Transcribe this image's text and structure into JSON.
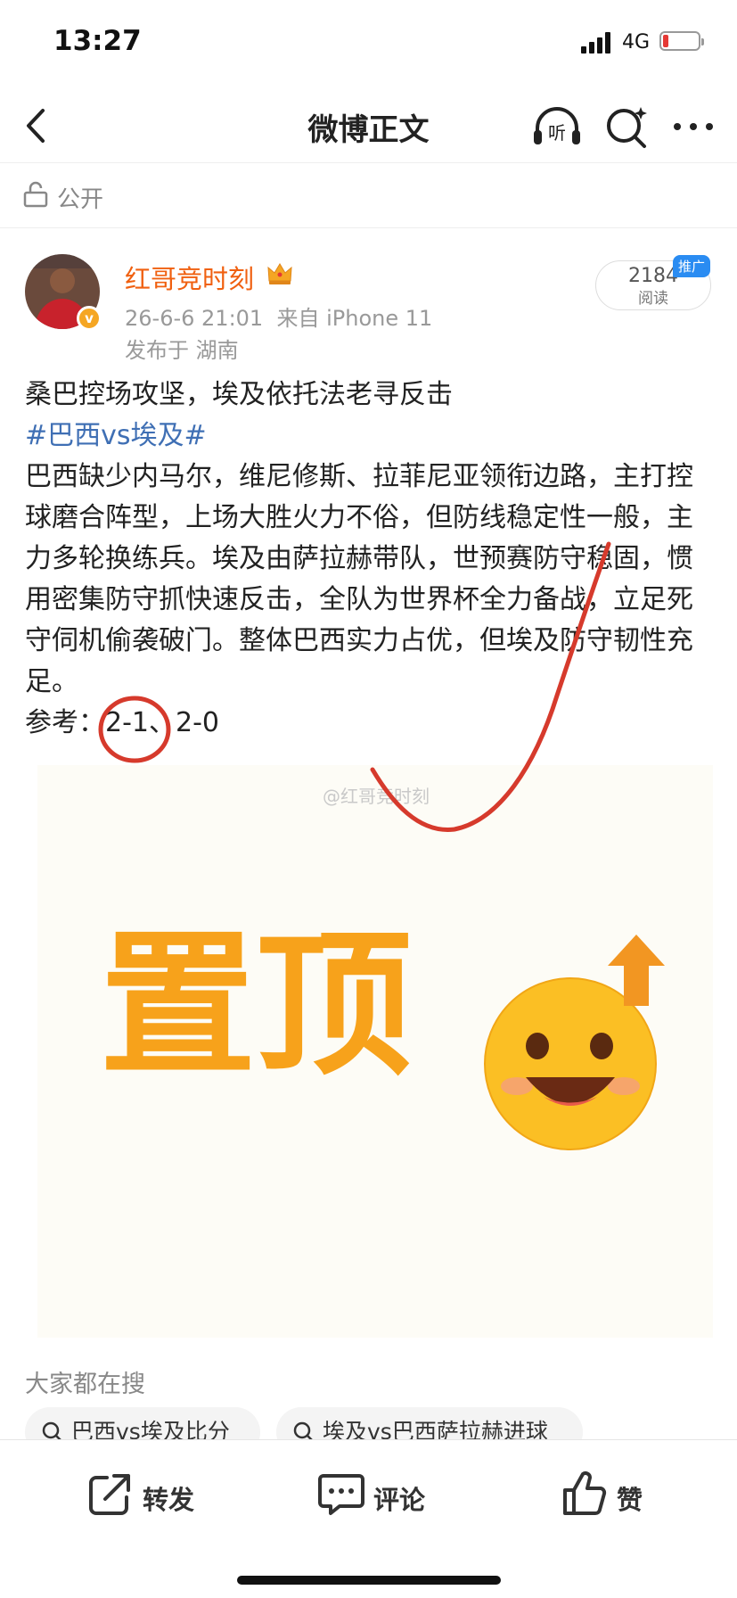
{
  "status": {
    "time": "13:27",
    "network": "4G",
    "battery_level": 0.15
  },
  "nav": {
    "title": "微博正文",
    "listen_label": "听"
  },
  "visibility": {
    "label": "公开"
  },
  "author": {
    "name": "红哥竞时刻",
    "date": "26-6-6 21:01",
    "source": "来自 iPhone 11",
    "location": "发布于 湖南",
    "verified_symbol": "v"
  },
  "stats": {
    "read_count": "2184",
    "read_label": "阅读",
    "promo_badge": "推广"
  },
  "post": {
    "line1": "桑巴控场攻坚，埃及依托法老寻反击",
    "hashtag": "#巴西vs埃及#",
    "body": "巴西缺少内马尔，维尼修斯、拉菲尼亚领衔边路，主打控球磨合阵型，上场大胜火力不俗，但防线稳定性一般，主力多轮换练兵。埃及由萨拉赫带队，世预赛防守稳固，惯用密集防守抓快速反击，全队为世界杯全力备战，立足死守伺机偷袭破门。整体巴西实力占优，但埃及防守韧性充足。",
    "reference_label": "参考：",
    "reference_score1": "2-1",
    "reference_sep": "、",
    "reference_score2": "2-0"
  },
  "image": {
    "watermark": "@红哥竞时刻",
    "big_text": "置顶",
    "colors": {
      "text": "#f7a21b",
      "emoji": "#fbbf24",
      "arrow": "#f29622",
      "annotation": "#d63a2c"
    }
  },
  "search": {
    "title": "大家都在搜",
    "chips": [
      {
        "label": "巴西vs埃及比分"
      },
      {
        "label": "埃及vs巴西萨拉赫进球"
      }
    ]
  },
  "actions": {
    "forward": "转发",
    "comment": "评论",
    "like": "赞"
  }
}
